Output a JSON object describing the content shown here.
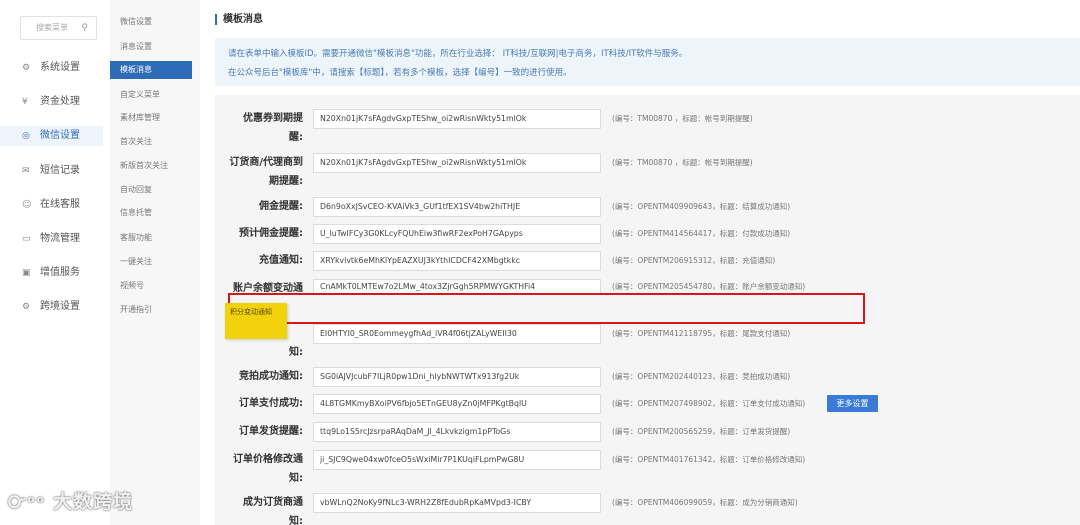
{
  "sidebar": {
    "search_placeholder": "搜索菜单",
    "items": [
      {
        "label": "系统设置",
        "icon": "⚙"
      },
      {
        "label": "资金处理",
        "icon": "¥"
      },
      {
        "label": "微信设置",
        "icon": "◎"
      },
      {
        "label": "短信记录",
        "icon": "✉"
      },
      {
        "label": "在线客服",
        "icon": "☺"
      },
      {
        "label": "物流管理",
        "icon": "▭"
      },
      {
        "label": "增值服务",
        "icon": "▣"
      },
      {
        "label": "跨境设置",
        "icon": "⚙"
      }
    ]
  },
  "subnav": {
    "items": [
      "微信设置",
      "消息设置",
      "模板消息",
      "自定义菜单",
      "素材库管理",
      "首次关注",
      "新版首次关注",
      "自动回复",
      "信息托管",
      "客服功能",
      "一键关注",
      "视频号",
      "开通指引"
    ]
  },
  "page_title": "模板消息",
  "notice": {
    "line1": "请在表单中输入模板ID。需要开通微信\"模板消息\"功能，所在行业选择：  IT科技/互联网|电子商务，IT科技/IT软件与服务。",
    "line2": "在公众号后台\"模板库\"中，请搜索【标题】，若有多个模板，选择【编号】一致的进行使用。"
  },
  "rows": [
    {
      "label": "优惠券到期提",
      "label2": "醒:",
      "value": "N20Xn01jK7sFAgdvGxpTEShw_oi2wRisnWkty51mlOk",
      "note": "(编号：TM00870 ，标题：帐号到期提醒)"
    },
    {
      "label": "订货商/代理商到",
      "label2": "期提醒:",
      "value": "N20Xn01jK7sFAgdvGxpTEShw_oi2wRisnWkty51mlOk",
      "note": "(编号：TM00870 ，标题：帐号到期提醒)"
    },
    {
      "label": "佣金提醒:",
      "label2": "",
      "value": "D6n9oXxJSvCEO-KVAiVk3_GUf1tfEX1SV4bw2hiTHJE",
      "note": "(编号：OPENTM409909643，标题：结算成功通知)"
    },
    {
      "label": "预计佣金提醒:",
      "label2": "",
      "value": "U_luTwIFCy3G0KLcyFQUhEiw3fiwRF2exPoH7GApyps",
      "note": "(编号：OPENTM414564417，标题：付款成功通知)"
    },
    {
      "label": "充值通知:",
      "label2": "",
      "value": "XRYkvlvtk6eMhKlYpEAZXUJ3kYthICDCF42XMbgtkkc",
      "note": "(编号：OPENTM206915312，标题：充值通知)"
    },
    {
      "label": "账户余额变动通",
      "label2": "",
      "value": "CnAMkT0LMTEw7o2LMw_4tox3ZjrGgh5RPMWYGKTHFi4",
      "note": "(编号：OPENTM205454780，标题：账户余额变动通知)"
    },
    {
      "label": "",
      "label2": "知:",
      "value": "EI0HTYI0_SR0EommeygfhAd_iVR4f06tjZALyWEII30",
      "note": "(编号：OPENTM412118795，标题：尾款支付通知)"
    },
    {
      "label": "竞拍成功通知:",
      "label2": "",
      "value": "SG0iAJVJcubF7ILjR0pw1Dni_hlybNWTWTx913fg2Uk",
      "note": "(编号：OPENTM202440123，标题：竞拍成功通知)"
    },
    {
      "label": "订单支付成功:",
      "label2": "",
      "value": "4L8TGMKmyBXoiPV6fbjo5ETnGEU8yZn0jMFPKgtBqlU",
      "note": "(编号：OPENTM207498902，标题：订单支付成功通知)"
    },
    {
      "label": "订单发货提醒:",
      "label2": "",
      "value": "ttq9Lo1S5rcJzsrpaRAqDaM_Jl_4Lkvkzigm1pPToGs",
      "note": "(编号：OPENTM200565259，标题：订单发货提醒)"
    },
    {
      "label": "订单价格修改通",
      "label2": "知:",
      "value": "ji_SJC9Qwe04xw0fceO5sWxiMir7P1KUqiFLpmPwG8U",
      "note": "(编号：OPENTM401761342，标题：订单价格修改通知)"
    },
    {
      "label": "成为订货商通",
      "label2": "知:",
      "value": "vbWLnQ2NoKy9fNLc3-WRH2Z8fEdubRpKaMVpd3-ICBY",
      "note": "(编号：OPENTM406099059，标题：成为分销商通知)"
    }
  ],
  "more_button": "更多设置",
  "popup_tag": "积分变动通知",
  "watermark": "大数跨境",
  "colors": {
    "accent": "#2f6cb8",
    "highlight": "#d9171b",
    "tag": "#f2d20c"
  }
}
